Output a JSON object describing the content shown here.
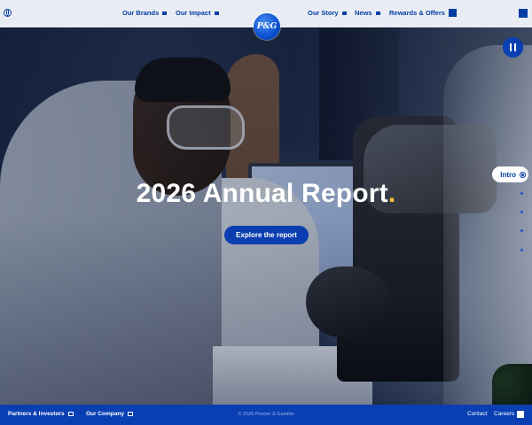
{
  "header": {
    "left_nav": [
      {
        "label": "Our Brands"
      },
      {
        "label": "Our Impact"
      }
    ],
    "logo_text": "P&G",
    "right_nav": [
      {
        "label": "Our Story"
      },
      {
        "label": "News"
      },
      {
        "label": "Rewards & Offers"
      }
    ]
  },
  "hero": {
    "title": "2026 Annual Report",
    "title_accent": ".",
    "cta_label": "Explore the report",
    "side_nav": {
      "active_label": "Intro",
      "dot_count": 4
    }
  },
  "footer": {
    "left_links": [
      {
        "label": "Partners & Investors"
      },
      {
        "label": "Our Company"
      }
    ],
    "copyright": "© 2026 Procter & Gamble",
    "right_links": [
      {
        "label": "Contact"
      },
      {
        "label": "Careers"
      }
    ]
  },
  "colors": {
    "brand_blue": "#003da5",
    "footer_blue": "#0a3fb4",
    "accent_yellow": "#f7c631",
    "header_bg": "#e9edf3"
  },
  "icons": {
    "globe": "globe-icon",
    "pause": "pause-icon",
    "menu": "menu-icon"
  }
}
